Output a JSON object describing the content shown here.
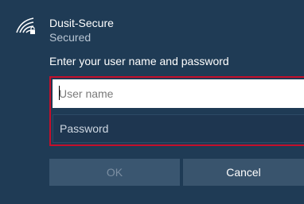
{
  "network": {
    "name": "Dusit-Secure",
    "status": "Secured",
    "icon": "wifi-secured-icon"
  },
  "login": {
    "prompt": "Enter your user name and password",
    "username_value": "",
    "username_placeholder": "User name",
    "password_value": "",
    "password_placeholder": "Password"
  },
  "buttons": {
    "ok_label": "OK",
    "cancel_label": "Cancel"
  },
  "colors": {
    "background": "#1f3b55",
    "highlight_border": "#c40f2b"
  }
}
